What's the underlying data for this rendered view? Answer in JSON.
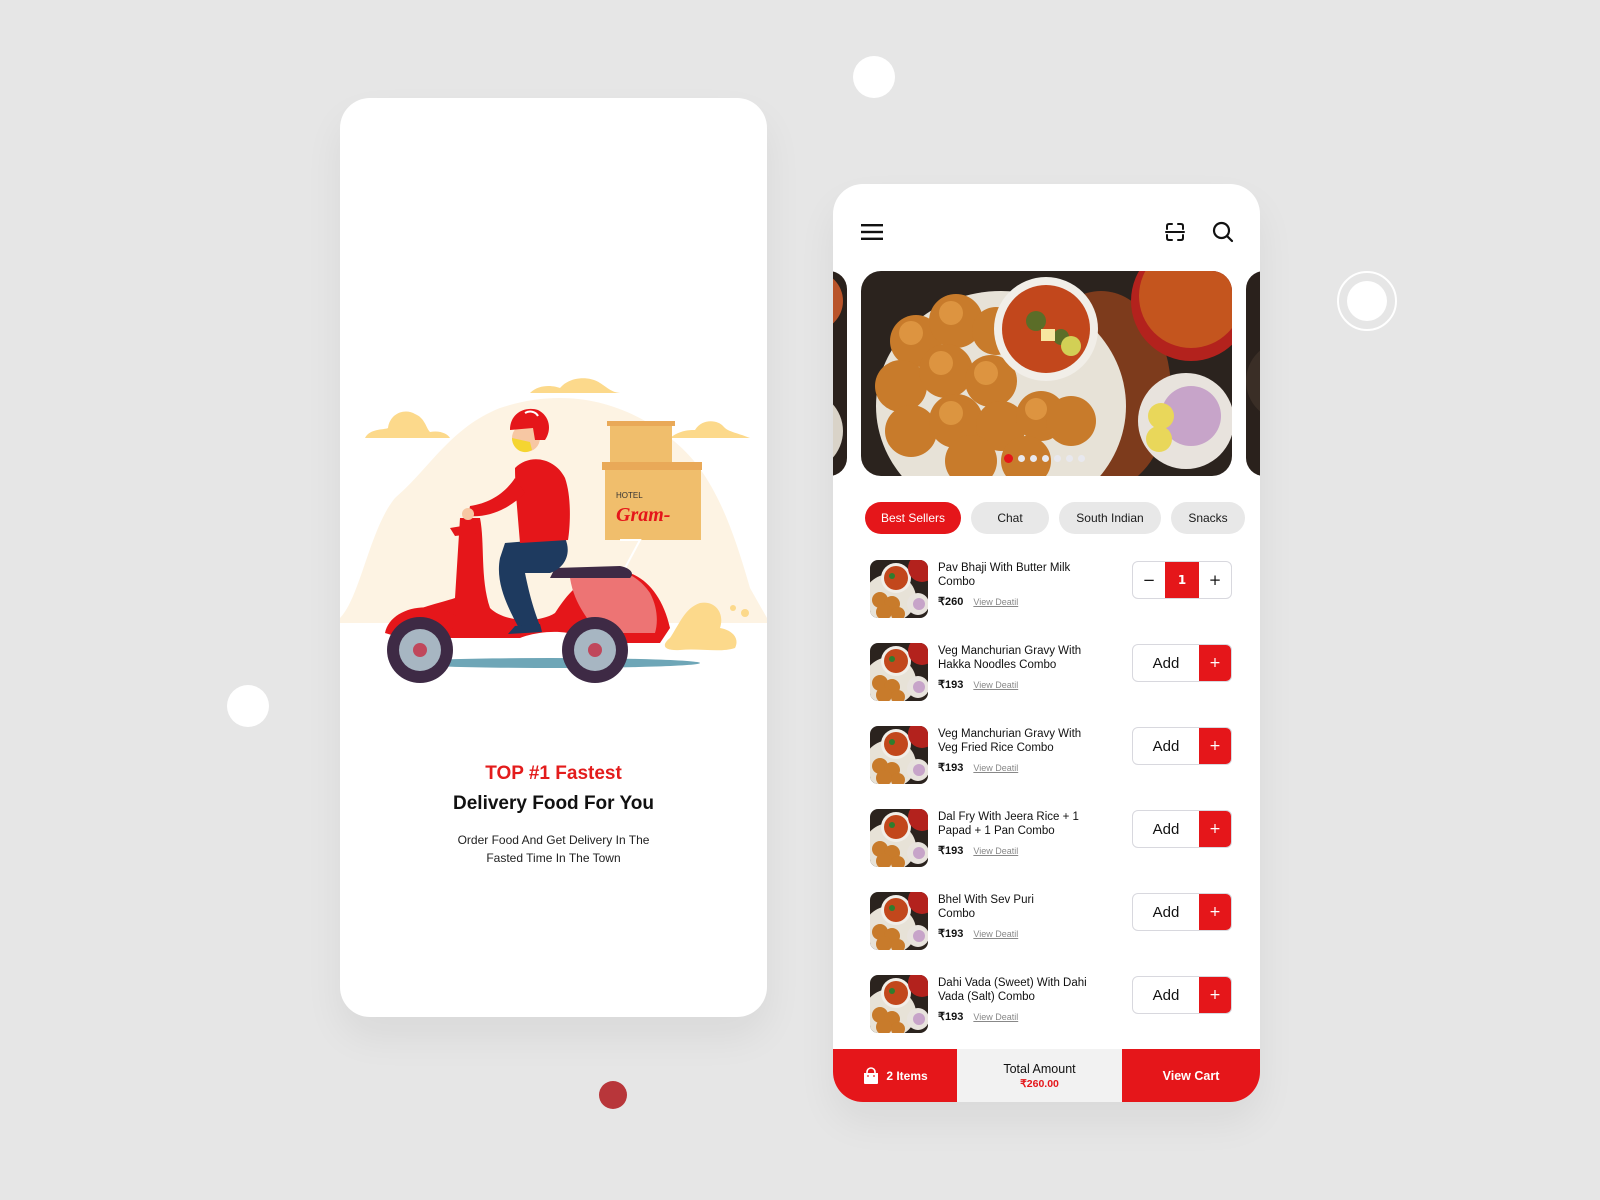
{
  "splash": {
    "title_highlight": "TOP #1 Fastest",
    "title": "Delivery Food For You",
    "subtitle_line1": "Order Food And Get Delivery In The",
    "subtitle_line2": "Fasted Time In The Town",
    "box_label_small": "HOTEL",
    "box_label_brand": "Gram-"
  },
  "menu_screen": {
    "icons": {
      "menu": "hamburger-menu-icon",
      "scan": "scan-icon",
      "search": "search-icon"
    },
    "carousel": {
      "slide_count": 7,
      "active_index": 0
    },
    "categories": [
      {
        "label": "Best Sellers",
        "active": true
      },
      {
        "label": "Chat",
        "active": false
      },
      {
        "label": "South Indian",
        "active": false
      },
      {
        "label": "Snacks",
        "active": false
      }
    ],
    "items": [
      {
        "name": "Pav Bhaji With Butter Milk Combo",
        "price": "₹260",
        "detail_link": "View Deatil",
        "quantity": "1",
        "in_cart": true
      },
      {
        "name": "Veg Manchurian Gravy With Hakka Noodles Combo",
        "price": "₹193",
        "detail_link": "View Deatil",
        "add_label": "Add",
        "in_cart": false
      },
      {
        "name": "Veg Manchurian Gravy With Veg Fried Rice Combo",
        "price": "₹193",
        "detail_link": "View Deatil",
        "add_label": "Add",
        "in_cart": false
      },
      {
        "name": "Dal Fry With Jeera Rice + 1 Papad + 1 Pan Combo",
        "price": "₹193",
        "detail_link": "View Deatil",
        "add_label": "Add",
        "in_cart": false
      },
      {
        "name": "Bhel With Sev Puri Combo",
        "price": "₹193",
        "detail_link": "View Deatil",
        "add_label": "Add",
        "in_cart": false
      },
      {
        "name": "Dahi Vada (Sweet) With Dahi Vada (Salt) Combo",
        "price": "₹193",
        "detail_link": "View Deatil",
        "add_label": "Add",
        "in_cart": false
      }
    ],
    "qty_minus": "−",
    "qty_plus": "+",
    "add_plus": "+",
    "bottom_bar": {
      "items_label": "2 Items",
      "total_label": "Total Amount",
      "total_value": "₹260.00",
      "view_cart_label": "View Cart"
    }
  },
  "colors": {
    "accent": "#e5161a",
    "background": "#e6e6e6",
    "card": "#ffffff",
    "chip_inactive": "#e8e8e8"
  }
}
